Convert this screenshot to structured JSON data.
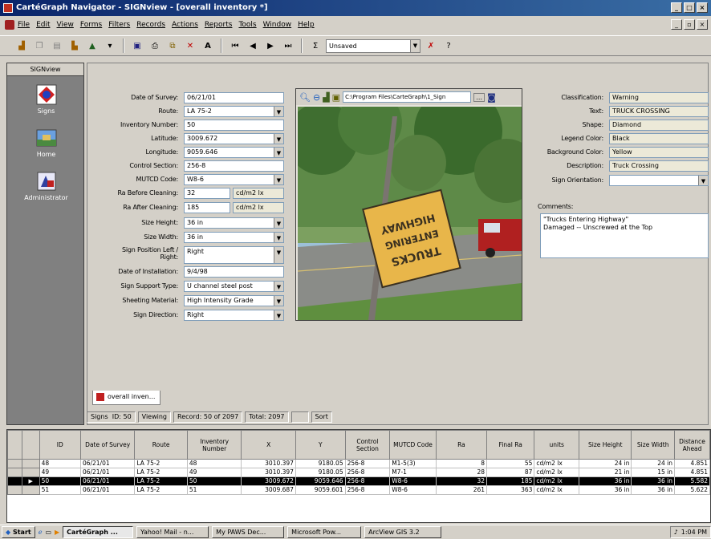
{
  "window": {
    "title": "CartéGraph Navigator - SIGNview - [overall inventory *]"
  },
  "menu": [
    "File",
    "Edit",
    "View",
    "Forms",
    "Filters",
    "Records",
    "Actions",
    "Reports",
    "Tools",
    "Window",
    "Help"
  ],
  "toolbar": {
    "view_select": "Unsaved"
  },
  "leftnav": {
    "header": "SIGNview",
    "items": [
      {
        "label": "Signs"
      },
      {
        "label": "Home"
      },
      {
        "label": "Administrator"
      }
    ]
  },
  "form": {
    "date_of_survey": {
      "label": "Date of Survey:",
      "value": "06/21/01"
    },
    "route": {
      "label": "Route:",
      "value": "LA 75-2"
    },
    "inventory_number": {
      "label": "Inventory Number:",
      "value": "50"
    },
    "latitude": {
      "label": "Latitude:",
      "value": "3009.672"
    },
    "longitude": {
      "label": "Longitude:",
      "value": "9059.646"
    },
    "control_section": {
      "label": "Control Section:",
      "value": "256-8"
    },
    "mutcd_code": {
      "label": "MUTCD Code:",
      "value": "W8-6"
    },
    "ra_before": {
      "label": "Ra Before Cleaning:",
      "value": "32",
      "unit": "cd/m2 lx"
    },
    "ra_after": {
      "label": "Ra After Cleaning:",
      "value": "185",
      "unit": "cd/m2 lx"
    },
    "size_height": {
      "label": "Size Height:",
      "value": "36 in"
    },
    "size_width": {
      "label": "Size Width:",
      "value": "36 in"
    },
    "sign_position": {
      "label": "Sign Position Left / Right:",
      "value": "Right"
    },
    "date_installation": {
      "label": "Date of Installation:",
      "value": "9/4/98"
    },
    "support_type": {
      "label": "Sign Support Type:",
      "value": "U channel steel post"
    },
    "sheeting_material": {
      "label": "Sheeting Material:",
      "value": "High Intensity Grade"
    },
    "sign_direction": {
      "label": "Sign Direction:",
      "value": "Right"
    }
  },
  "photo": {
    "path": "C:\\Program Files\\CarteGraph\\1_Sign",
    "sign_text_1": "TRUCKS",
    "sign_text_2": "ENTERING",
    "sign_text_3": "HIGHWAY"
  },
  "right": {
    "classification": {
      "label": "Classification:",
      "value": "Warning"
    },
    "text": {
      "label": "Text:",
      "value": "TRUCK CROSSING"
    },
    "shape": {
      "label": "Shape:",
      "value": "Diamond"
    },
    "legend_color": {
      "label": "Legend Color:",
      "value": "Black"
    },
    "background_color": {
      "label": "Background Color:",
      "value": "Yellow"
    },
    "description": {
      "label": "Description:",
      "value": "Truck Crossing"
    },
    "sign_orientation": {
      "label": "Sign Orientation:",
      "value": ""
    },
    "comments_label": "Comments:",
    "comments_line1": "\"Trucks Entering Highway\"",
    "comments_line2": "Damaged -- Unscrewed at the Top"
  },
  "tab": {
    "label": "overall inven..."
  },
  "status": {
    "layer": "Signs",
    "id": "ID: 50",
    "mode": "Viewing",
    "record": "Record: 50 of 2097",
    "total": "Total: 2097",
    "sort": "Sort"
  },
  "grid": {
    "columns": [
      "ID",
      "Date of Survey",
      "Route",
      "Inventory Number",
      "X",
      "Y",
      "Control Section",
      "MUTCD Code",
      "Ra",
      "Final Ra",
      "units",
      "Size Height",
      "Size Width",
      "Distance Ahead"
    ],
    "rows": [
      [
        "48",
        "06/21/01",
        "LA 75-2",
        "48",
        "3010.397",
        "9180.05",
        "256-8",
        "M1-5(3)",
        "8",
        "55",
        "cd/m2 lx",
        "24 in",
        "24 in",
        "4.851"
      ],
      [
        "49",
        "06/21/01",
        "LA 75-2",
        "49",
        "3010.397",
        "9180.05",
        "256-8",
        "M7-1",
        "28",
        "87",
        "cd/m2 lx",
        "21 in",
        "15 in",
        "4.851"
      ],
      [
        "50",
        "06/21/01",
        "LA 75-2",
        "50",
        "3009.672",
        "9059.646",
        "256-8",
        "W8-6",
        "32",
        "185",
        "cd/m2 lx",
        "36 in",
        "36 in",
        "5.582"
      ],
      [
        "51",
        "06/21/01",
        "LA 75-2",
        "51",
        "3009.687",
        "9059.601",
        "256-8",
        "W8-6",
        "261",
        "363",
        "cd/m2 lx",
        "36 in",
        "36 in",
        "5.622"
      ]
    ]
  },
  "taskbar": {
    "start": "Start",
    "items": [
      "CartéGraph ...",
      "Yahoo! Mail - n...",
      "My PAWS Dec...",
      "Microsoft Pow...",
      "ArcView GIS 3.2"
    ],
    "clock": "1:04 PM"
  },
  "colors": {
    "titlebar": "#0a246a",
    "selection": "#000000",
    "sign_yellow": "#e8b64a"
  }
}
